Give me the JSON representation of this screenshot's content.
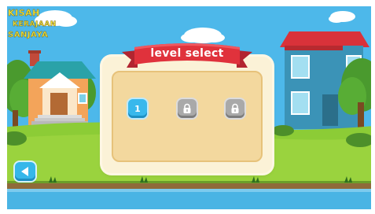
{
  "game": {
    "title_lines": [
      "KISAH",
      "KERAJAAN",
      "SANJAYA"
    ],
    "panel_title": "level select",
    "levels": [
      {
        "label": "1",
        "state": "unlocked"
      },
      {
        "label": "",
        "state": "locked"
      },
      {
        "label": "",
        "state": "locked"
      }
    ],
    "back_icon": "back-arrow-icon",
    "colors": {
      "sky": "#4db8ea",
      "grass": "#8ccc36",
      "water": "#49b4e4",
      "banner_red": "#e0323c",
      "panel_cream": "#fbf2d7",
      "panel_inner": "#f3d89e",
      "button_blue": "#38b8ec",
      "locked_gray": "#a9a9a9",
      "title_yellow": "#f3e33a"
    }
  }
}
